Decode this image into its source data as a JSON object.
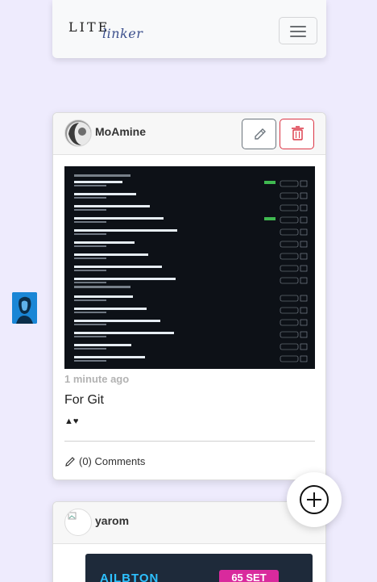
{
  "navbar": {
    "logo_text_1": "LITE",
    "logo_text_2": "linker",
    "toggler_icon": "hamburger-icon"
  },
  "posts": [
    {
      "username": "MoAmine",
      "time": "1 minute ago",
      "title": "For Git",
      "reactions": "▲♥",
      "comments": "(0) Comments",
      "edit_icon": "pencil-icon",
      "delete_icon": "trash-icon"
    },
    {
      "username": "yarom",
      "product_brand": "AILBTON",
      "product_badge": "65 SET"
    }
  ],
  "fab": {
    "icon": "plus-circle-icon"
  },
  "colors": {
    "background": "#eeebfd",
    "danger": "#dc3545",
    "secondary": "#6c757d",
    "muted": "#b3b3b3"
  }
}
